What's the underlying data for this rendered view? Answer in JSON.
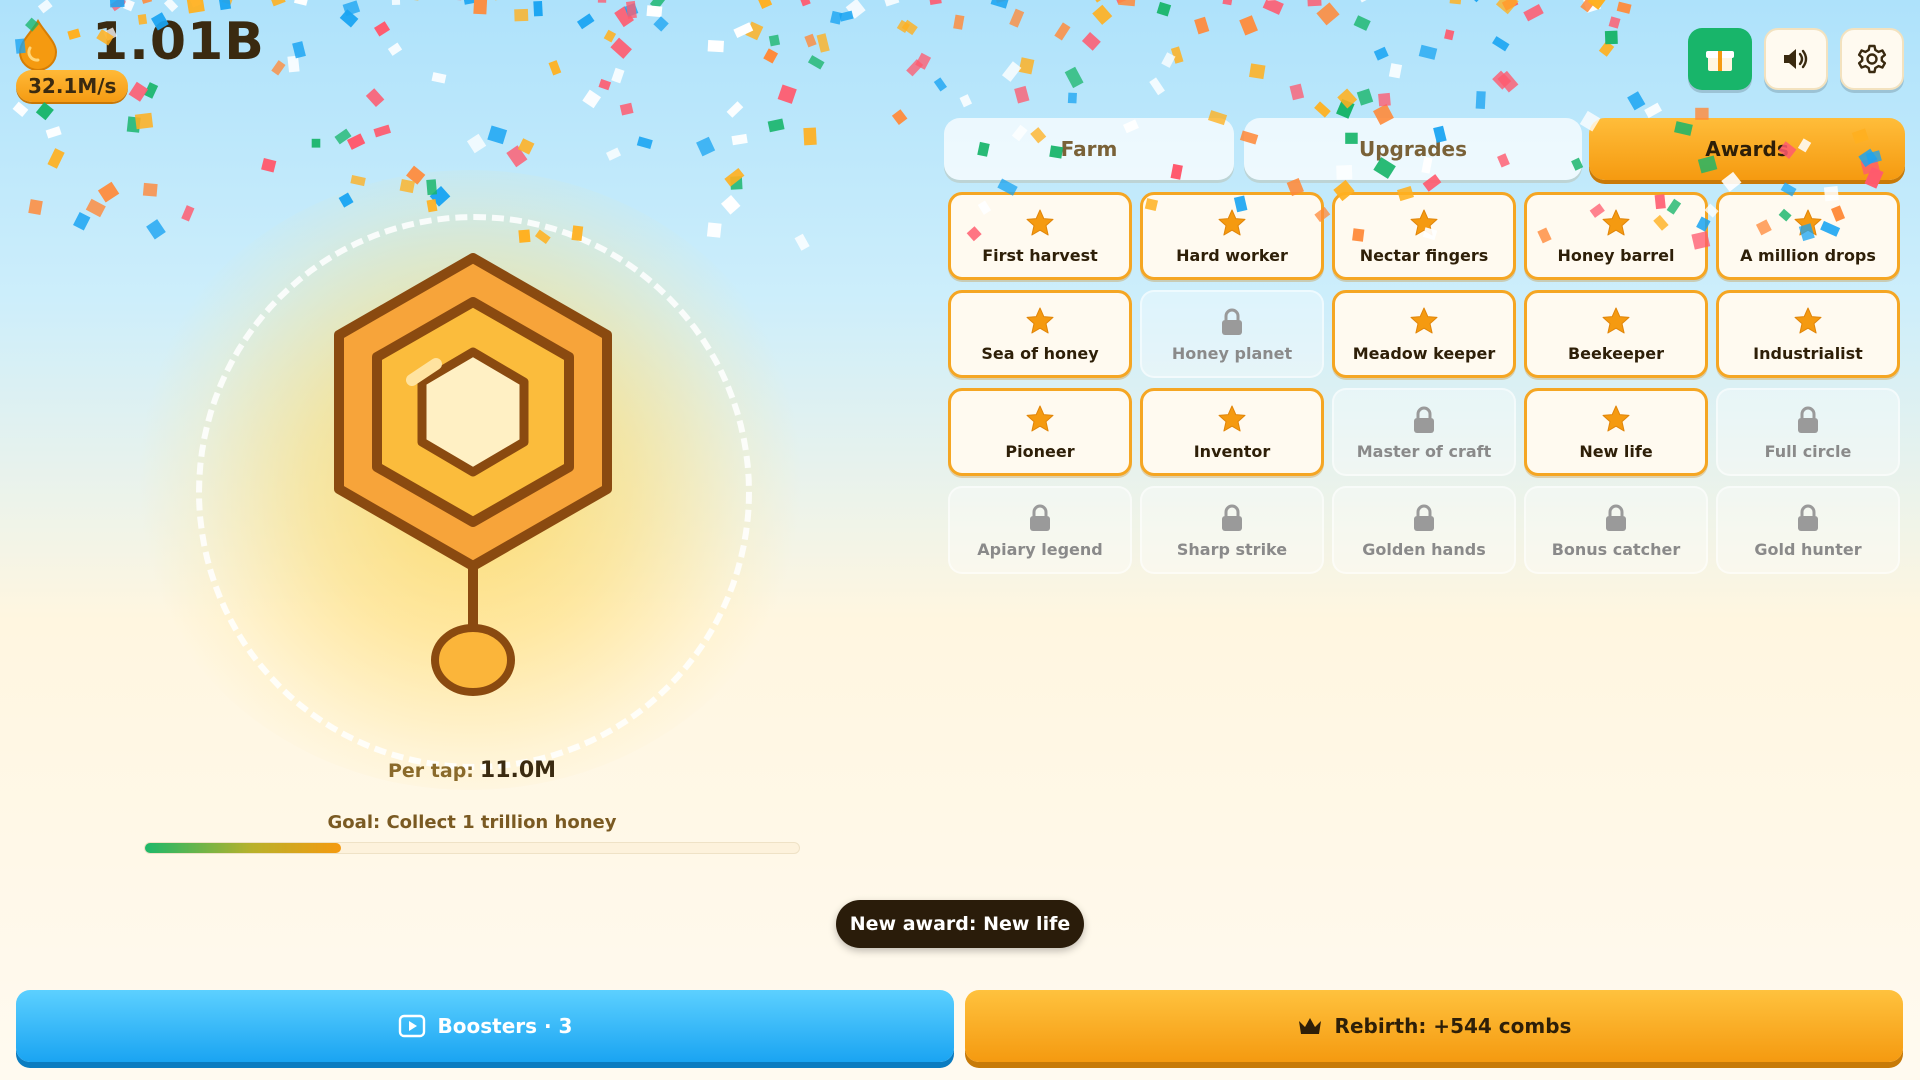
{
  "stats": {
    "honey_total": "1.01B",
    "rate": "32.1M/s"
  },
  "top_buttons": {
    "gift": "gift-icon",
    "sound": "speaker-icon",
    "settings": "gear-icon"
  },
  "tabs": {
    "farm": "Farm",
    "upgrades": "Upgrades",
    "awards": "Awards",
    "active": "awards"
  },
  "awards": [
    {
      "label": "First harvest",
      "unlocked": true
    },
    {
      "label": "Hard worker",
      "unlocked": true
    },
    {
      "label": "Nectar fingers",
      "unlocked": true
    },
    {
      "label": "Honey barrel",
      "unlocked": true
    },
    {
      "label": "A million drops",
      "unlocked": true
    },
    {
      "label": "Sea of honey",
      "unlocked": true
    },
    {
      "label": "Honey planet",
      "unlocked": false
    },
    {
      "label": "Meadow keeper",
      "unlocked": true
    },
    {
      "label": "Beekeeper",
      "unlocked": true
    },
    {
      "label": "Industrialist",
      "unlocked": true
    },
    {
      "label": "Pioneer",
      "unlocked": true
    },
    {
      "label": "Inventor",
      "unlocked": true
    },
    {
      "label": "Master of craft",
      "unlocked": false
    },
    {
      "label": "New life",
      "unlocked": true
    },
    {
      "label": "Full circle",
      "unlocked": false
    },
    {
      "label": "Apiary legend",
      "unlocked": false
    },
    {
      "label": "Sharp strike",
      "unlocked": false
    },
    {
      "label": "Golden hands",
      "unlocked": false
    },
    {
      "label": "Bonus catcher",
      "unlocked": false
    },
    {
      "label": "Gold hunter",
      "unlocked": false
    }
  ],
  "hive": {
    "per_tap_label": "Per tap:",
    "per_tap_value": "11.0M"
  },
  "goal": {
    "text": "Goal: Collect 1 trillion honey",
    "progress": 0.3
  },
  "toast": "New award: New life",
  "bottom": {
    "boosters_label": "Boosters · 3",
    "rebirth_label": "Rebirth: +544 combs"
  },
  "colors": {
    "accent": "#f59a10",
    "boost": "#1aa4f2",
    "gift": "#18b56a"
  }
}
